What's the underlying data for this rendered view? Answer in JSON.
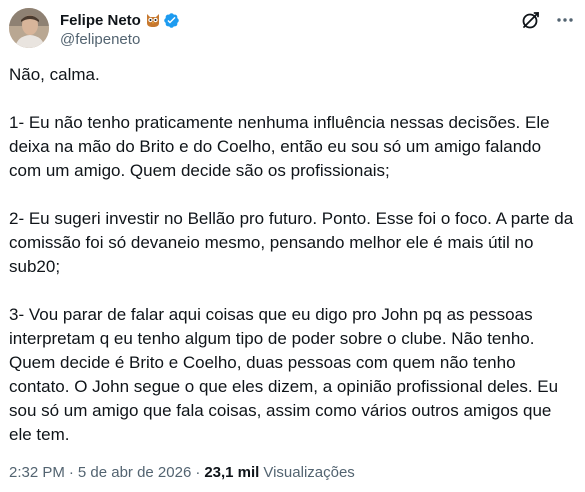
{
  "author": {
    "display_name": "Felipe Neto",
    "handle": "@felipeneto",
    "badge_icons": [
      "owl-icon",
      "verified-badge-icon"
    ],
    "verified_color": "#1d9bf0"
  },
  "actions": {
    "icons": [
      "grok-icon",
      "more-icon"
    ]
  },
  "tweet": {
    "paragraphs": [
      "Não, calma.",
      "1- Eu não tenho praticamente nenhuma influência nessas decisões. Ele deixa na mão do Brito e do Coelho, então eu sou só um amigo falando com um amigo. Quem decide são os profissionais;",
      "2- Eu sugeri investir no Bellão pro futuro. Ponto. Esse foi o foco. A parte da comissão foi só devaneio mesmo, pensando melhor ele é mais útil no sub20;",
      "3- Vou parar de falar aqui coisas que eu digo pro John pq as pessoas interpretam q eu tenho algum tipo de poder sobre o clube. Não tenho. Quem decide é Brito e Coelho, duas pessoas com quem não tenho contato. O John segue o que eles dizem, a opinião profissional deles. Eu sou só um amigo que fala coisas, assim como vários outros amigos que ele tem."
    ]
  },
  "meta": {
    "time": "2:32 PM",
    "separator": "·",
    "date": "5 de abr de 2026",
    "views_count": "23,1 mil",
    "views_label": "Visualizações"
  },
  "colors": {
    "text": "#0f1419",
    "secondary": "#536471",
    "accent": "#1d9bf0"
  }
}
